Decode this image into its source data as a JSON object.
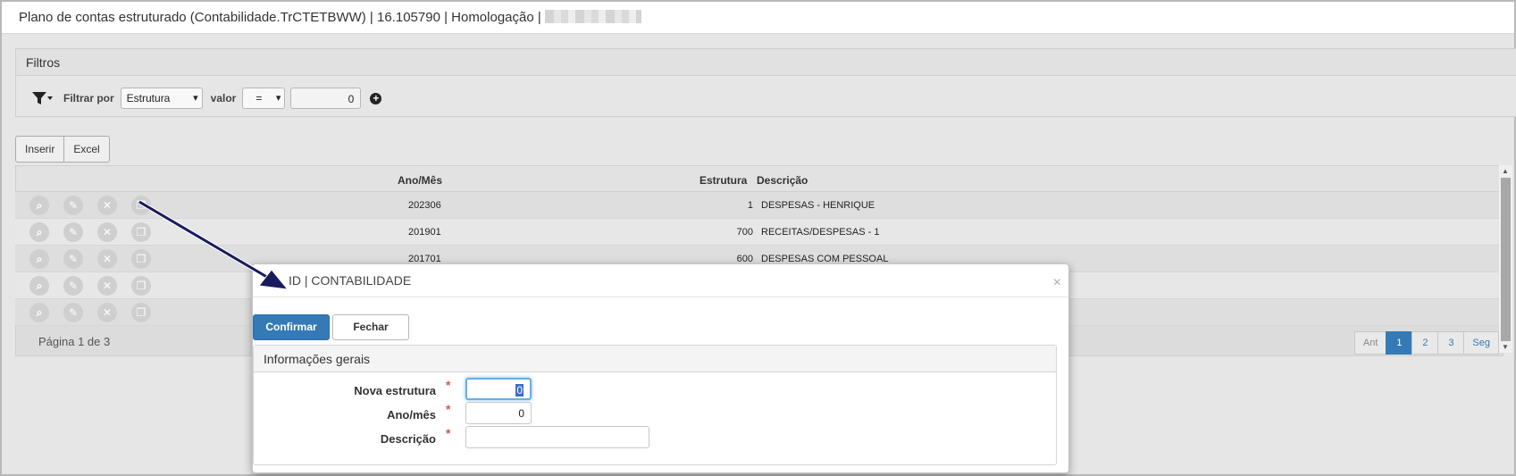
{
  "window": {
    "title": "Plano de contas estruturado (Contabilidade.TrCTETBWW) | 16.105790 | Homologação |"
  },
  "filters": {
    "title": "Filtros",
    "filter_by_label": "Filtrar por",
    "field_select": "Estrutura",
    "value_label": "valor",
    "operator_select": "=",
    "value_input": "0"
  },
  "toolbar": {
    "insert_label": "Inserir",
    "excel_label": "Excel"
  },
  "table": {
    "columns": [
      "Ano/Mês",
      "Estrutura",
      "Descrição"
    ],
    "rows": [
      {
        "ano_mes": "202306",
        "estrutura": "1",
        "descricao": "DESPESAS - HENRIQUE"
      },
      {
        "ano_mes": "201901",
        "estrutura": "700",
        "descricao": "RECEITAS/DESPESAS - 1"
      },
      {
        "ano_mes": "201701",
        "estrutura": "600",
        "descricao": "DESPESAS COM PESSOAL"
      },
      {
        "ano_mes": "",
        "estrutura": "",
        "descricao": ""
      },
      {
        "ano_mes": "",
        "estrutura": "",
        "descricao": ""
      }
    ],
    "page_info": "Página 1 de 3",
    "pager": [
      "Ant",
      "1",
      "2",
      "3",
      "Seg"
    ]
  },
  "modal": {
    "title": "ID | CONTABILIDADE",
    "confirm_label": "Confirmar",
    "close_label": "Fechar",
    "section_title": "Informações gerais",
    "fields": [
      {
        "label": "Nova estrutura",
        "value": "0"
      },
      {
        "label": "Ano/mês",
        "value": "0"
      },
      {
        "label": "Descrição",
        "value": ""
      }
    ]
  },
  "colors": {
    "primary": "#337ab7",
    "required": "#d9534f",
    "arrow": "#1a1a5e"
  }
}
